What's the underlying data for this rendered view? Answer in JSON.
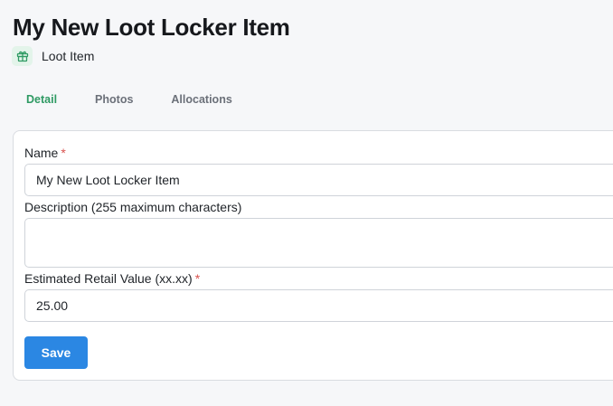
{
  "header": {
    "title": "My New Loot Locker Item",
    "subtitle": "Loot Item",
    "subtitle_icon": "gift-icon",
    "accent_color": "#2e9a63"
  },
  "tabs": [
    {
      "label": "Detail",
      "active": true
    },
    {
      "label": "Photos",
      "active": false
    },
    {
      "label": "Allocations",
      "active": false
    }
  ],
  "form": {
    "name": {
      "label": "Name",
      "required_mark": "*",
      "value": "My New Loot Locker Item"
    },
    "description": {
      "label": "Description (255 maximum characters)",
      "value": ""
    },
    "retail_value": {
      "label": "Estimated Retail Value (xx.xx)",
      "required_mark": "*",
      "value": "25.00"
    },
    "save_label": "Save",
    "save_color": "#2b87e3"
  }
}
